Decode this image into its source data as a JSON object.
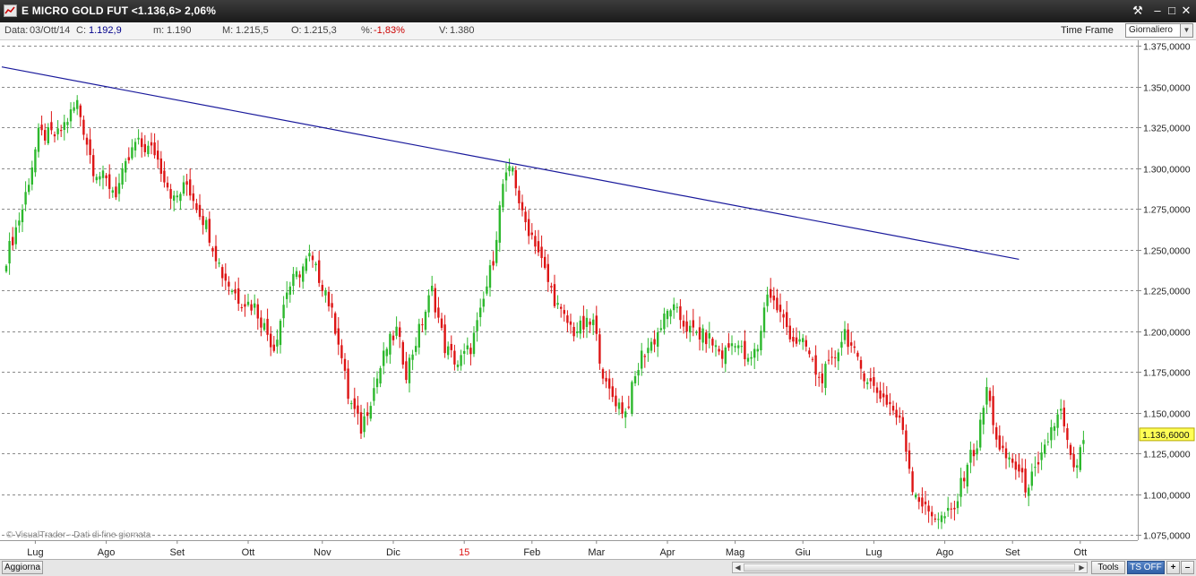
{
  "window": {
    "title": "E MICRO GOLD FUT <1.136,6> 2,06%",
    "buttons": {
      "tools_glyph": "⚒",
      "minimize_glyph": "–",
      "maximize_glyph": "□",
      "close_glyph": "✕"
    }
  },
  "infobar": {
    "data_label": "Data:",
    "data_value": "03/Ott/14",
    "close_label": "C:",
    "close_value": "1.192,9",
    "min_label": "m:",
    "min_value": "1.190",
    "max_label": "M:",
    "max_value": "1.215,5",
    "open_label": "O:",
    "open_value": "1.215,3",
    "pct_label": "%:",
    "pct_value": "-1,83%",
    "vol_label": "V:",
    "vol_value": "1.380",
    "timeframe_label": "Time Frame",
    "timeframe_value": "Giornaliero"
  },
  "chart_data": {
    "type": "candlestick",
    "watermark": "© VisualTrader - Dati di fine giornata",
    "y_ticks": [
      "1.375,0000",
      "1.350,0000",
      "1.325,0000",
      "1.300,0000",
      "1.275,0000",
      "1.250,0000",
      "1.225,0000",
      "1.200,0000",
      "1.175,0000",
      "1.150,0000",
      "1.125,0000",
      "1.100,0000",
      "1.075,0000"
    ],
    "ylim": [
      1062.5,
      1387.5
    ],
    "x_labels": [
      {
        "label": "Lug",
        "index": 9
      },
      {
        "label": "Ago",
        "index": 31
      },
      {
        "label": "Set",
        "index": 53
      },
      {
        "label": "Ott",
        "index": 75
      },
      {
        "label": "Nov",
        "index": 98
      },
      {
        "label": "Dic",
        "index": 120
      },
      {
        "label": "15",
        "index": 142,
        "highlight": true
      },
      {
        "label": "Feb",
        "index": 163
      },
      {
        "label": "Mar",
        "index": 183
      },
      {
        "label": "Apr",
        "index": 205
      },
      {
        "label": "Mag",
        "index": 226
      },
      {
        "label": "Giu",
        "index": 247
      },
      {
        "label": "Lug",
        "index": 269
      },
      {
        "label": "Ago",
        "index": 291
      },
      {
        "label": "Set",
        "index": 312
      },
      {
        "label": "Ott",
        "index": 333
      }
    ],
    "current_price": "1.136,6000",
    "current_value": 1136.6,
    "trendline": {
      "start_index": 0,
      "start_value": 1362,
      "end_index": 314,
      "end_value": 1244
    },
    "anchors": [
      [
        0,
        1245
      ],
      [
        5,
        1275
      ],
      [
        10,
        1320
      ],
      [
        16,
        1320
      ],
      [
        22,
        1340
      ],
      [
        27,
        1300
      ],
      [
        34,
        1285
      ],
      [
        40,
        1315
      ],
      [
        46,
        1310
      ],
      [
        52,
        1280
      ],
      [
        56,
        1290
      ],
      [
        62,
        1265
      ],
      [
        67,
        1235
      ],
      [
        72,
        1220
      ],
      [
        77,
        1215
      ],
      [
        83,
        1190
      ],
      [
        87,
        1225
      ],
      [
        94,
        1245
      ],
      [
        99,
        1225
      ],
      [
        103,
        1195
      ],
      [
        106,
        1160
      ],
      [
        110,
        1140
      ],
      [
        114,
        1165
      ],
      [
        118,
        1190
      ],
      [
        121,
        1200
      ],
      [
        124,
        1175
      ],
      [
        128,
        1200
      ],
      [
        132,
        1225
      ],
      [
        136,
        1190
      ],
      [
        140,
        1180
      ],
      [
        144,
        1190
      ],
      [
        147,
        1210
      ],
      [
        151,
        1245
      ],
      [
        154,
        1290
      ],
      [
        157,
        1300
      ],
      [
        160,
        1270
      ],
      [
        164,
        1255
      ],
      [
        168,
        1230
      ],
      [
        172,
        1210
      ],
      [
        176,
        1200
      ],
      [
        182,
        1205
      ],
      [
        186,
        1165
      ],
      [
        192,
        1150
      ],
      [
        197,
        1185
      ],
      [
        201,
        1195
      ],
      [
        206,
        1215
      ],
      [
        212,
        1200
      ],
      [
        218,
        1195
      ],
      [
        222,
        1185
      ],
      [
        226,
        1195
      ],
      [
        230,
        1180
      ],
      [
        233,
        1190
      ],
      [
        236,
        1225
      ],
      [
        240,
        1210
      ],
      [
        244,
        1195
      ],
      [
        248,
        1190
      ],
      [
        252,
        1170
      ],
      [
        256,
        1180
      ],
      [
        260,
        1200
      ],
      [
        264,
        1180
      ],
      [
        269,
        1165
      ],
      [
        274,
        1155
      ],
      [
        278,
        1140
      ],
      [
        281,
        1105
      ],
      [
        285,
        1090
      ],
      [
        290,
        1085
      ],
      [
        294,
        1090
      ],
      [
        298,
        1120
      ],
      [
        301,
        1130
      ],
      [
        304,
        1165
      ],
      [
        308,
        1125
      ],
      [
        312,
        1120
      ],
      [
        316,
        1105
      ],
      [
        320,
        1115
      ],
      [
        324,
        1140
      ],
      [
        327,
        1150
      ],
      [
        330,
        1120
      ],
      [
        332,
        1115
      ],
      [
        334,
        1135
      ]
    ],
    "candle_count": 335,
    "candle_colors": {
      "up": "#2db82d",
      "down": "#dd1515"
    },
    "trendline_color": "#1a1a9c"
  },
  "bottombar": {
    "refresh_label": "Aggiorna",
    "tools_label": "Tools",
    "tsoff_label": "TS OFF",
    "plus_label": "+",
    "minus_label": "–"
  }
}
